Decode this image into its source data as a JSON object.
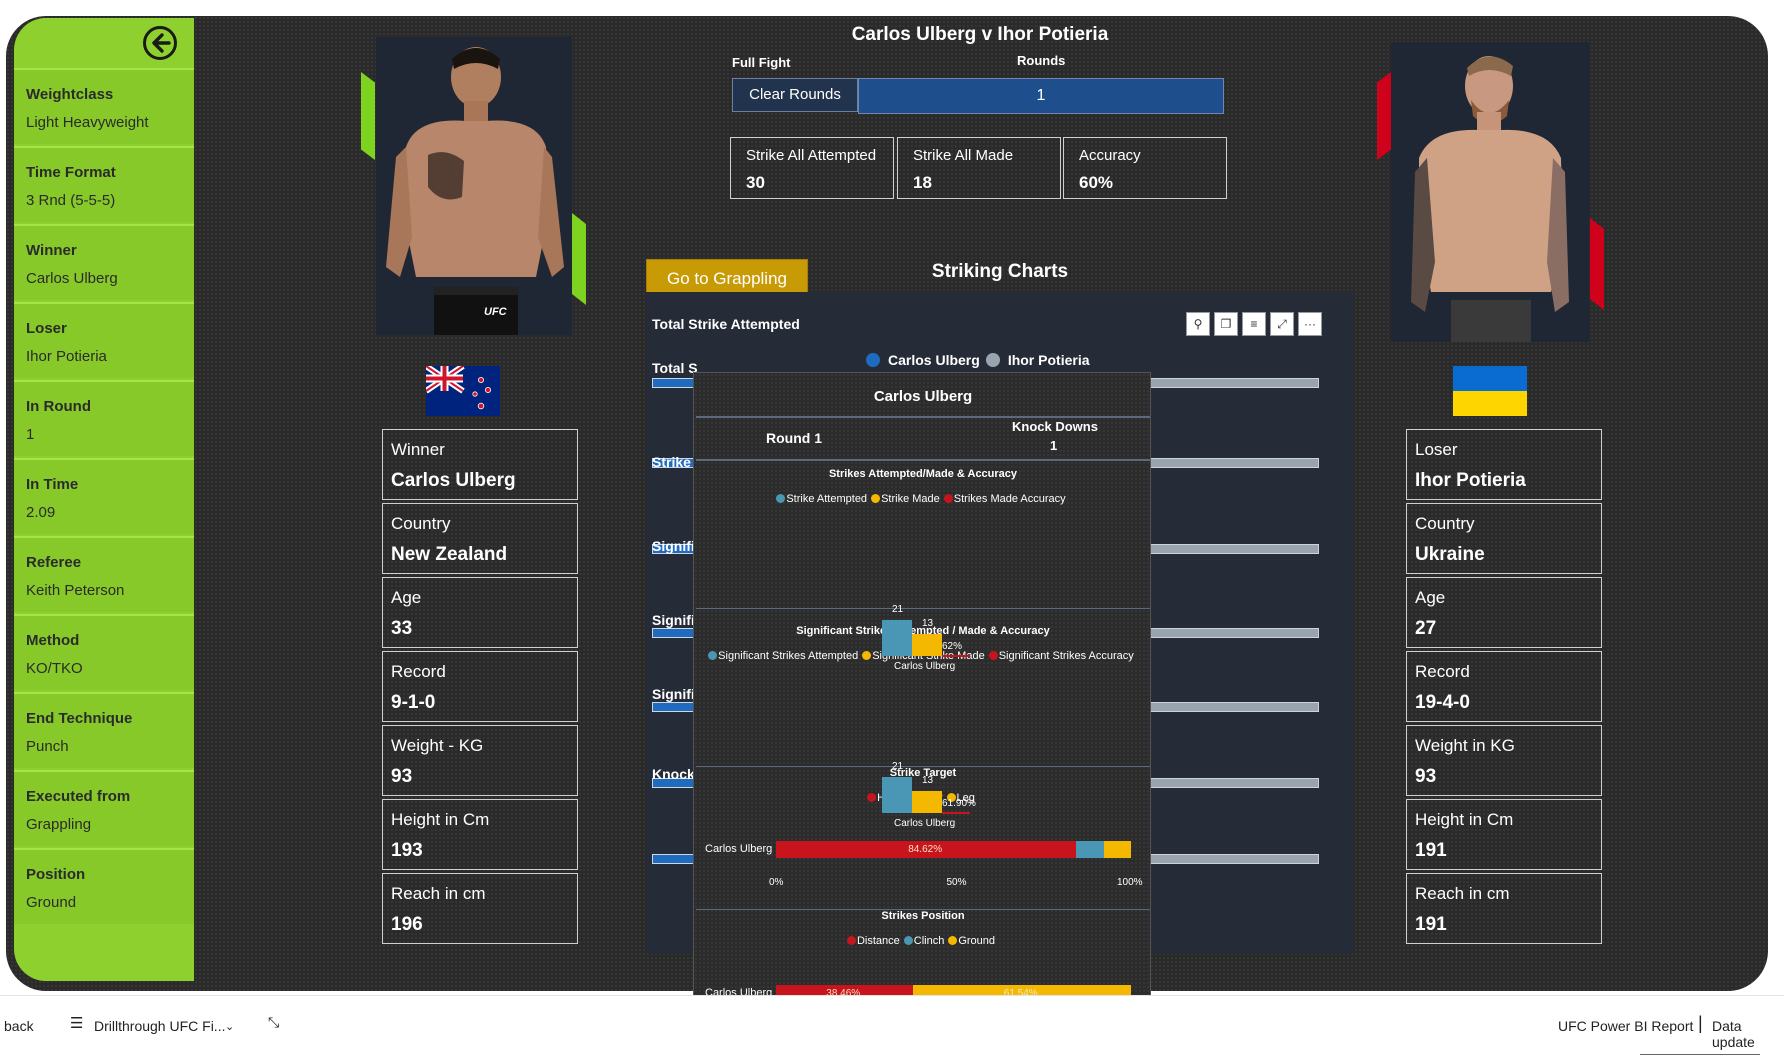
{
  "header": {
    "match_title": "Carlos Ulberg v Ihor Potieria",
    "full_fight_label": "Full Fight",
    "rounds_label": "Rounds",
    "clear_rounds_label": "Clear Rounds",
    "round_selected": "1"
  },
  "kpis": [
    {
      "label": "Strike All Attempted",
      "value": "30"
    },
    {
      "label": "Strike All Made",
      "value": "18"
    },
    {
      "label": "Accuracy",
      "value": "60%"
    }
  ],
  "sidebar": {
    "items": [
      {
        "title": "Weightclass",
        "value": "Light Heavyweight"
      },
      {
        "title": "Time Format",
        "value": "3 Rnd (5-5-5)"
      },
      {
        "title": "Winner",
        "value": "Carlos Ulberg"
      },
      {
        "title": "Loser",
        "value": "Ihor Potieria"
      },
      {
        "title": "In Round",
        "value": "1"
      },
      {
        "title": "In Time",
        "value": "2.09"
      },
      {
        "title": "Referee",
        "value": "Keith Peterson"
      },
      {
        "title": "Method",
        "value": "KO/TKO"
      },
      {
        "title": "End Technique",
        "value": "Punch"
      },
      {
        "title": "Executed from",
        "value": "Grappling"
      },
      {
        "title": "Position",
        "value": "Ground"
      }
    ]
  },
  "fighter_left": {
    "stats": [
      {
        "label": "Winner",
        "value": "Carlos Ulberg"
      },
      {
        "label": "Country",
        "value": "New Zealand"
      },
      {
        "label": "Age",
        "value": "33"
      },
      {
        "label": "Record",
        "value": "9-1-0"
      },
      {
        "label": "Weight - KG",
        "value": "93"
      },
      {
        "label": "Height in Cm",
        "value": "193"
      },
      {
        "label": "Reach in cm",
        "value": "196"
      }
    ],
    "accent_color": "#7ed321",
    "trunks_text": "UFC"
  },
  "fighter_right": {
    "stats": [
      {
        "label": "Loser",
        "value": "Ihor Potieria"
      },
      {
        "label": "Country",
        "value": "Ukraine"
      },
      {
        "label": "Age",
        "value": "27"
      },
      {
        "label": "Record",
        "value": "19-4-0"
      },
      {
        "label": "Weight in KG",
        "value": "93"
      },
      {
        "label": "Height in Cm",
        "value": "191"
      },
      {
        "label": "Reach in cm",
        "value": "191"
      }
    ],
    "accent_color": "#d0021b"
  },
  "buttons": {
    "grappling": "Go to Grappling"
  },
  "striking": {
    "title": "Striking Charts",
    "panel_title": "Total Strike Attempted",
    "legend": [
      "Carlos Ulberg",
      "Ihor Potieria"
    ],
    "legend_colors": [
      "#1f6bc0",
      "#9aa3b0"
    ],
    "row_labels": [
      "Total S",
      "Strike",
      "Signifi",
      "Signifi",
      "Signifi",
      "Knock"
    ],
    "toolbar_icons": [
      "pin-icon",
      "copy-icon",
      "filter-icon",
      "focus-icon",
      "more-icon"
    ],
    "toolbar_glyphs": [
      "⚲",
      "❐",
      "≡",
      "⤢",
      "···"
    ]
  },
  "tooltip": {
    "fighter": "Carlos Ulberg",
    "round_label": "Round 1",
    "knockdowns_label": "Knock Downs",
    "knockdowns_value": "1",
    "sections": [
      {
        "title": "Strikes Attempted/Made & Accuracy",
        "legend": [
          "Strike Attempted",
          "Strike Made",
          "Strikes Made Accuracy"
        ]
      },
      {
        "title": "Significant Strikes Attempted / Made & Accuracy",
        "legend": [
          "Significant Strikes Attempted",
          "Significant Strike Made",
          "Significant Strikes Accuracy"
        ]
      },
      {
        "title": "Strike Target",
        "legend": [
          "Head",
          "Body",
          "Leg"
        ]
      },
      {
        "title": "Strikes Position",
        "legend": [
          "Distance",
          "Clinch",
          "Ground"
        ]
      }
    ],
    "legend_colors": {
      "attempted": "#4a97b5",
      "made": "#f5b800",
      "accuracy": "#c8141c"
    },
    "axis_ticks": [
      "0%",
      "50%",
      "100%"
    ]
  },
  "chart_data": [
    {
      "type": "bar",
      "title": "Strikes Attempted/Made & Accuracy",
      "categories": [
        "Carlos Ulberg"
      ],
      "series": [
        {
          "name": "Strike Attempted",
          "values": [
            21
          ]
        },
        {
          "name": "Strike Made",
          "values": [
            13
          ]
        },
        {
          "name": "Strikes Made Accuracy",
          "values": [
            0.62
          ]
        }
      ],
      "labels": [
        "21",
        "13",
        "62%"
      ]
    },
    {
      "type": "bar",
      "title": "Significant Strikes Attempted / Made & Accuracy",
      "categories": [
        "Carlos Ulberg"
      ],
      "series": [
        {
          "name": "Significant Strikes Attempted",
          "values": [
            21
          ]
        },
        {
          "name": "Significant Strike Made",
          "values": [
            13
          ]
        },
        {
          "name": "Significant Strikes Accuracy",
          "values": [
            0.619
          ]
        }
      ],
      "labels": [
        "21",
        "13",
        "61.90%"
      ]
    },
    {
      "type": "bar",
      "title": "Strike Target",
      "categories": [
        "Carlos Ulberg"
      ],
      "series": [
        {
          "name": "Head",
          "values": [
            84.62
          ]
        },
        {
          "name": "Body",
          "values": [
            7.69
          ]
        },
        {
          "name": "Leg",
          "values": [
            7.69
          ]
        }
      ],
      "labels": [
        "84.62%"
      ],
      "xlim": [
        0,
        100
      ]
    },
    {
      "type": "bar",
      "title": "Strikes Position",
      "categories": [
        "Carlos Ulberg"
      ],
      "series": [
        {
          "name": "Distance",
          "values": [
            38.46
          ]
        },
        {
          "name": "Clinch",
          "values": [
            0
          ]
        },
        {
          "name": "Ground",
          "values": [
            61.54
          ]
        }
      ],
      "labels": [
        "38.46%",
        "61.54%"
      ],
      "xlim": [
        0,
        100
      ]
    }
  ],
  "statusbar": {
    "back": "back",
    "page": "Drillthrough UFC Fi...",
    "report_name": "UFC Power BI Report",
    "data_update": "Data update"
  }
}
